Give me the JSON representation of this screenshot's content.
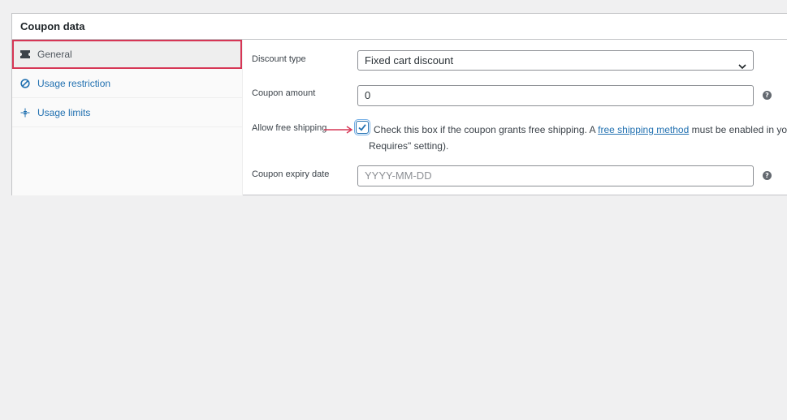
{
  "panel": {
    "title": "Coupon data"
  },
  "sidebar": {
    "tabs": [
      {
        "label": "General",
        "icon": "ticket-icon",
        "active": true
      },
      {
        "label": "Usage restriction",
        "icon": "restriction-icon",
        "active": false
      },
      {
        "label": "Usage limits",
        "icon": "limits-icon",
        "active": false
      }
    ]
  },
  "fields": {
    "discount_type": {
      "label": "Discount type",
      "value": "Fixed cart discount"
    },
    "coupon_amount": {
      "label": "Coupon amount",
      "value": "0",
      "help": "?"
    },
    "free_shipping": {
      "label": "Allow free shipping",
      "checked": true,
      "description_before": "Check this box if the coupon grants free shipping. A ",
      "link_text": "free shipping method",
      "description_after": " must be enabled in your shi",
      "description_line2": "Requires\" setting)."
    },
    "expiry_date": {
      "label": "Coupon expiry date",
      "placeholder": "YYYY-MM-DD",
      "help": "?"
    }
  },
  "colors": {
    "accent": "#2271b1",
    "highlight": "#d63655",
    "background": "#f0f0f1"
  }
}
